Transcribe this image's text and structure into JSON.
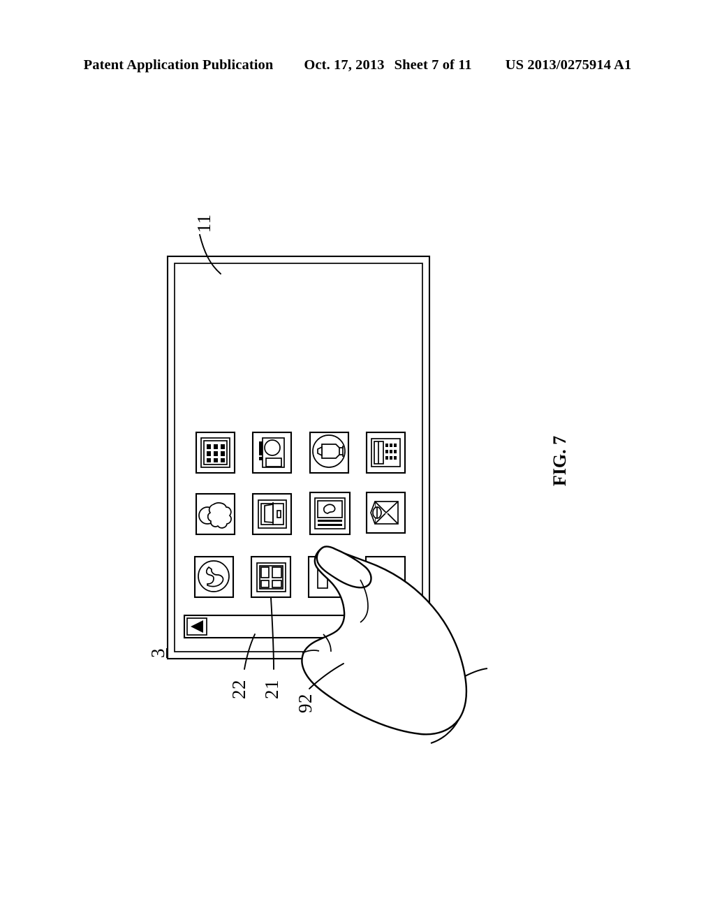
{
  "header": {
    "publication": "Patent Application Publication",
    "date": "Oct. 17, 2013",
    "sheet": "Sheet 7 of 11",
    "document_number": "US 2013/0275914 A1"
  },
  "figure": {
    "label": "FIG. 7",
    "orientation": "rotated-90-ccw",
    "description": "Handheld touchscreen device held and touched by a user's hand"
  },
  "reference_numerals": [
    {
      "id": "11",
      "label": "11",
      "refers_to": "display-screen-area"
    },
    {
      "id": "3",
      "label": "3",
      "refers_to": "handheld-device-body",
      "underlined": true
    },
    {
      "id": "22",
      "label": "22",
      "refers_to": "bottom-toolbar-bar"
    },
    {
      "id": "21",
      "label": "21",
      "refers_to": "application-icon"
    },
    {
      "id": "92",
      "label": "92",
      "refers_to": "user-hand-finger"
    }
  ],
  "device": {
    "name": "handheld-device",
    "screen_name": "touch-screen",
    "icon_grid": {
      "rows": 3,
      "columns": 4,
      "icons": [
        {
          "row": 1,
          "col": 1,
          "name": "calculator-icon",
          "label": "Calculator"
        },
        {
          "row": 1,
          "col": 2,
          "name": "camera-icon",
          "label": "Camera"
        },
        {
          "row": 1,
          "col": 3,
          "name": "media-player-icon",
          "label": "Media Player"
        },
        {
          "row": 1,
          "col": 4,
          "name": "telephone-keypad-icon",
          "label": "Phone Keypad"
        },
        {
          "row": 2,
          "col": 1,
          "name": "weather-cloud-icon",
          "label": "Weather"
        },
        {
          "row": 2,
          "col": 2,
          "name": "book-reader-icon",
          "label": "Reader"
        },
        {
          "row": 2,
          "col": 3,
          "name": "voicemail-handset-icon",
          "label": "Voicemail"
        },
        {
          "row": 2,
          "col": 4,
          "name": "envelope-mail-icon",
          "label": "Mail"
        },
        {
          "row": 3,
          "col": 1,
          "name": "clock-icon",
          "label": "Clock"
        },
        {
          "row": 3,
          "col": 2,
          "name": "layout-grid-icon",
          "label": "Layout"
        },
        {
          "row": 3,
          "col": 3,
          "name": "notes-icon",
          "label": "Notes"
        },
        {
          "row": 3,
          "col": 4,
          "name": "contacts-icon",
          "label": "Contacts"
        }
      ]
    },
    "toolbar": {
      "name": "bottom-toolbar",
      "back_button_glyph": "◁",
      "back_button_label": "Back"
    }
  },
  "colors": {
    "ink": "#000000",
    "paper": "#ffffff"
  }
}
